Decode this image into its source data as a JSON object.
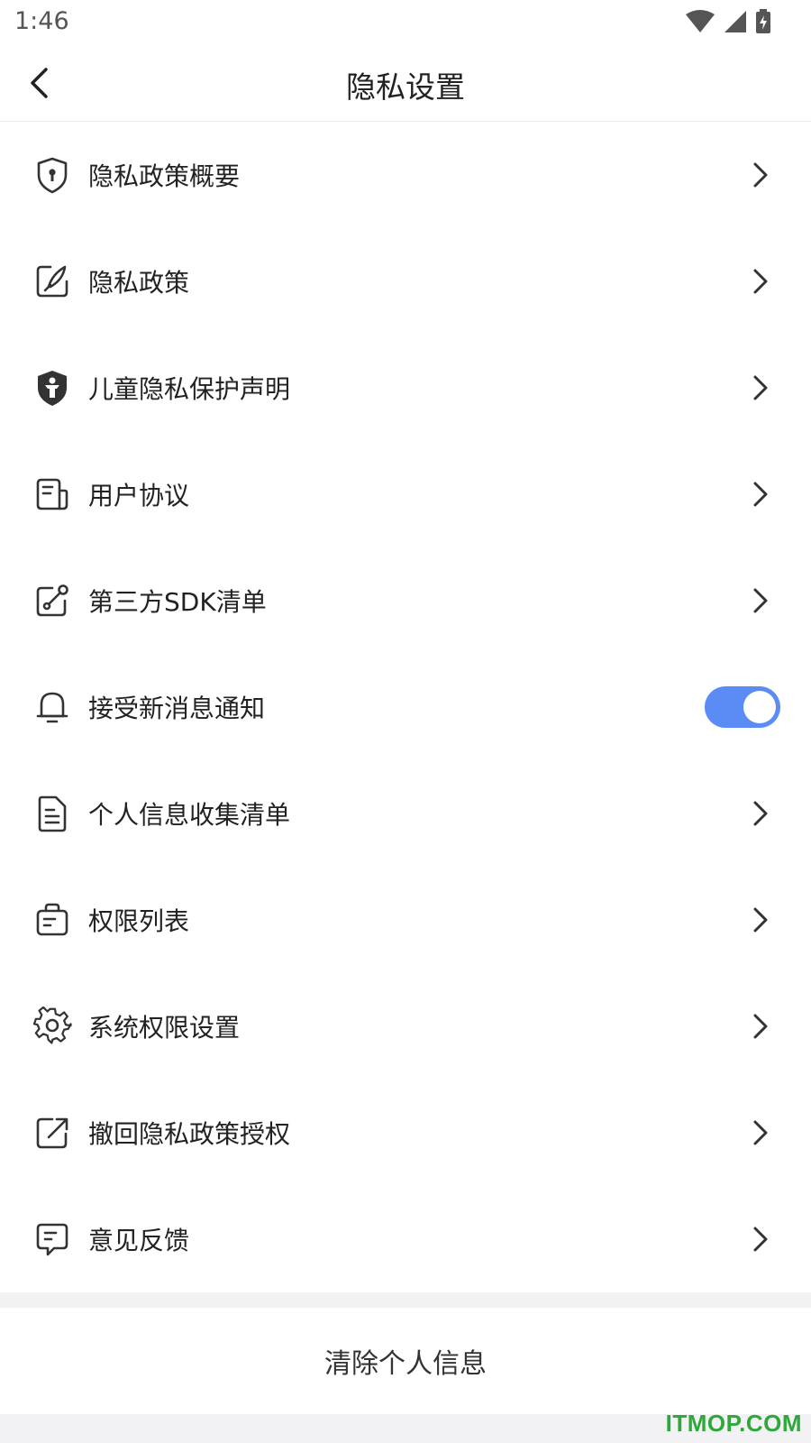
{
  "status_bar": {
    "time": "1:46",
    "icons": [
      "wifi-icon",
      "signal-icon",
      "battery-charging-icon"
    ]
  },
  "header": {
    "title": "隐私设置",
    "back_icon": "chevron-left-icon"
  },
  "menu": {
    "items": [
      {
        "label": "隐私政策概要",
        "icon": "shield-lock-icon",
        "control": "chevron"
      },
      {
        "label": "隐私政策",
        "icon": "edit-note-icon",
        "control": "chevron"
      },
      {
        "label": "儿童隐私保护声明",
        "icon": "child-shield-icon",
        "control": "chevron"
      },
      {
        "label": "用户协议",
        "icon": "document-icon",
        "control": "chevron"
      },
      {
        "label": "第三方SDK清单",
        "icon": "link-document-icon",
        "control": "chevron"
      },
      {
        "label": "接受新消息通知",
        "icon": "bell-icon",
        "control": "toggle",
        "toggle_on": true
      },
      {
        "label": "个人信息收集清单",
        "icon": "file-list-icon",
        "control": "chevron"
      },
      {
        "label": "权限列表",
        "icon": "bag-list-icon",
        "control": "chevron"
      },
      {
        "label": "系统权限设置",
        "icon": "gear-icon",
        "control": "chevron"
      },
      {
        "label": "撤回隐私政策授权",
        "icon": "share-out-icon",
        "control": "chevron"
      },
      {
        "label": "意见反馈",
        "icon": "message-icon",
        "control": "chevron"
      }
    ]
  },
  "clear_section": {
    "label": "清除个人信息"
  },
  "watermark": "ITMOP.COM",
  "colors": {
    "accent": "#5b8cf5",
    "watermark": "#2fa83a",
    "background": "#f2f2f4"
  }
}
